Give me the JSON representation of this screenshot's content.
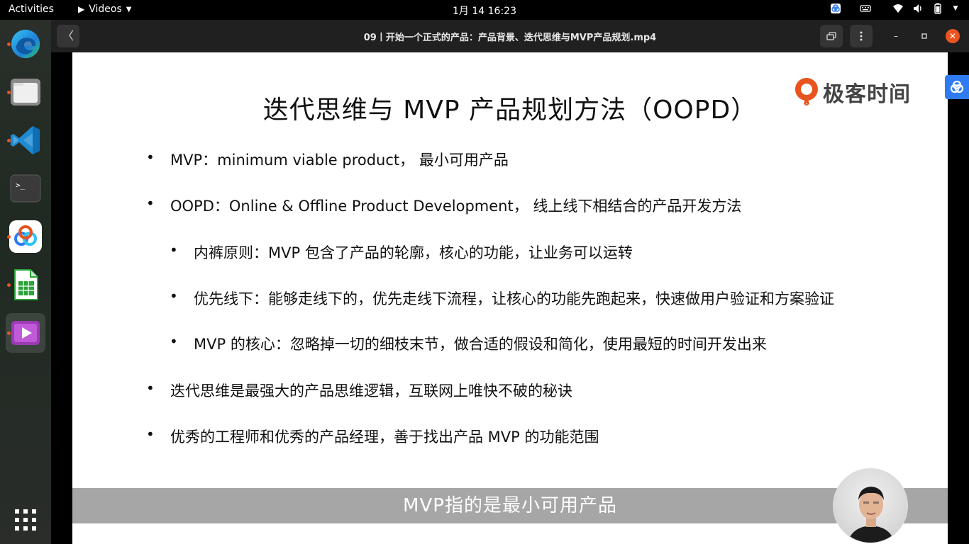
{
  "topbar": {
    "activities": "Activities",
    "app_name": "Videos",
    "clock": "1月 14  16:23"
  },
  "dock": {
    "items": [
      {
        "name": "Microsoft Edge"
      },
      {
        "name": "Files"
      },
      {
        "name": "Visual Studio Code"
      },
      {
        "name": "Terminal"
      },
      {
        "name": "Baidu Netdisk"
      },
      {
        "name": "LibreOffice Calc"
      },
      {
        "name": "Videos"
      }
    ]
  },
  "window": {
    "title": "09丨开始一个正式的产品：产品背景、迭代思维与MVP产品规划.mp4"
  },
  "slide": {
    "title": "迭代思维与 MVP 产品规划方法（OOPD）",
    "brand": "极客时间",
    "bullet_glyph": "•",
    "bullets": [
      "MVP：minimum viable product， 最小可用产品",
      "OOPD：Online & Offline Product Development， 线上线下相结合的产品开发方法",
      "内裤原则：MVP 包含了产品的轮廓，核心的功能，让业务可以运转",
      "优先线下：能够走线下的，优先走线下流程，让核心的功能先跑起来，快速做用户验证和方案验证",
      "MVP 的核心：忽略掉一切的细枝末节，做合适的假设和简化，使用最短的时间开发出来",
      "迭代思维是最强大的产品思维逻辑，互联网上唯快不破的秘诀",
      "优秀的工程师和优秀的产品经理，善于找出产品 MVP 的功能范围"
    ],
    "caption": "MVP指的是最小可用产品"
  },
  "colors": {
    "accent": "#e95420",
    "brand_orange": "#e8531e",
    "caption_bg": "#a6a6a6",
    "badge_blue": "#2f7bf2"
  }
}
